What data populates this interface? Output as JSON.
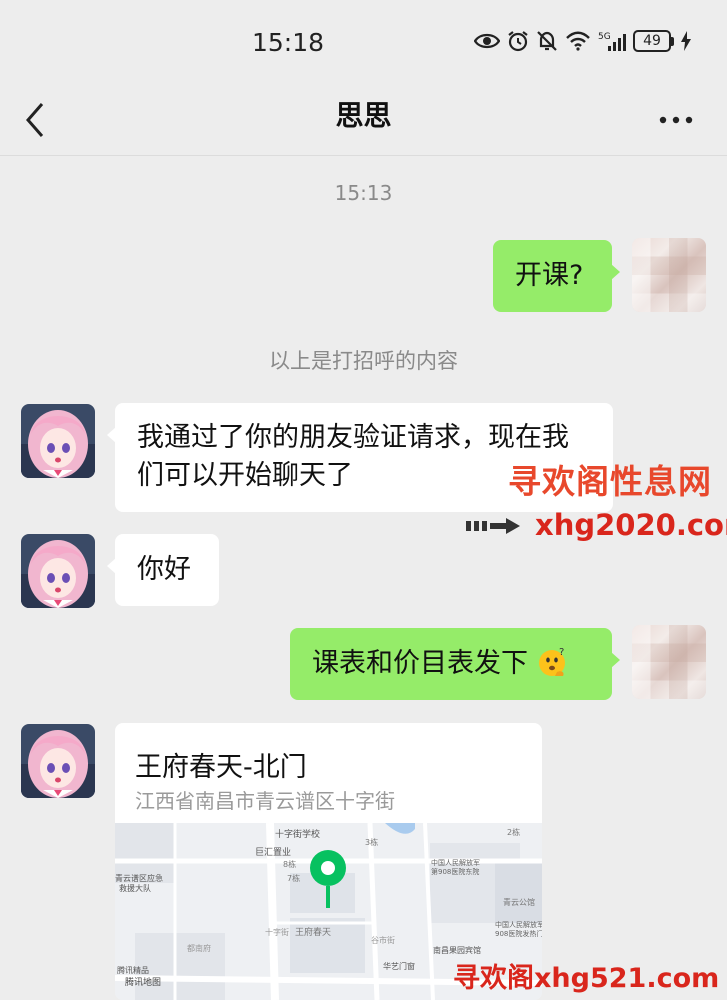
{
  "status_bar": {
    "time": "15:18",
    "battery": "49",
    "network": "5G"
  },
  "header": {
    "title": "思思"
  },
  "chat": {
    "timestamp": "15:13",
    "system_notice": "以上是打招呼的内容",
    "messages": [
      {
        "side": "out",
        "text": "开课?"
      },
      {
        "side": "in",
        "text": "我通过了你的朋友验证请求，现在我们可以开始聊天了"
      },
      {
        "side": "in",
        "text": "你好"
      },
      {
        "side": "out",
        "text": "课表和价目表发下",
        "emoji": "thinking-face"
      }
    ],
    "location": {
      "name": "王府春天-北门",
      "address": "江西省南昌市青云谱区十字街",
      "map_labels": [
        "十字街学校",
        "巨汇置业",
        "8栋",
        "7栋",
        "青云谱区应急救援大队",
        "王府春天",
        "中国人民解放军第908医院东院",
        "青云公馆",
        "中国人民解放军908医院发热门诊",
        "南昌果园宾馆",
        "华艺门窗",
        "都南府",
        "谷市街",
        "十字街",
        "2栋",
        "3栋"
      ],
      "map_provider": "腾讯地图",
      "map_provider_extra": "腾讯精品"
    }
  },
  "watermarks": {
    "site_name": "寻欢阁性息网",
    "site_url": "xhg2020.com",
    "bottom": "寻欢阁xhg521.com"
  },
  "colors": {
    "background": "#ededed",
    "bubble_out": "#95ec69",
    "bubble_in": "#ffffff",
    "pin": "#07c160",
    "watermark": "#d9261c"
  }
}
